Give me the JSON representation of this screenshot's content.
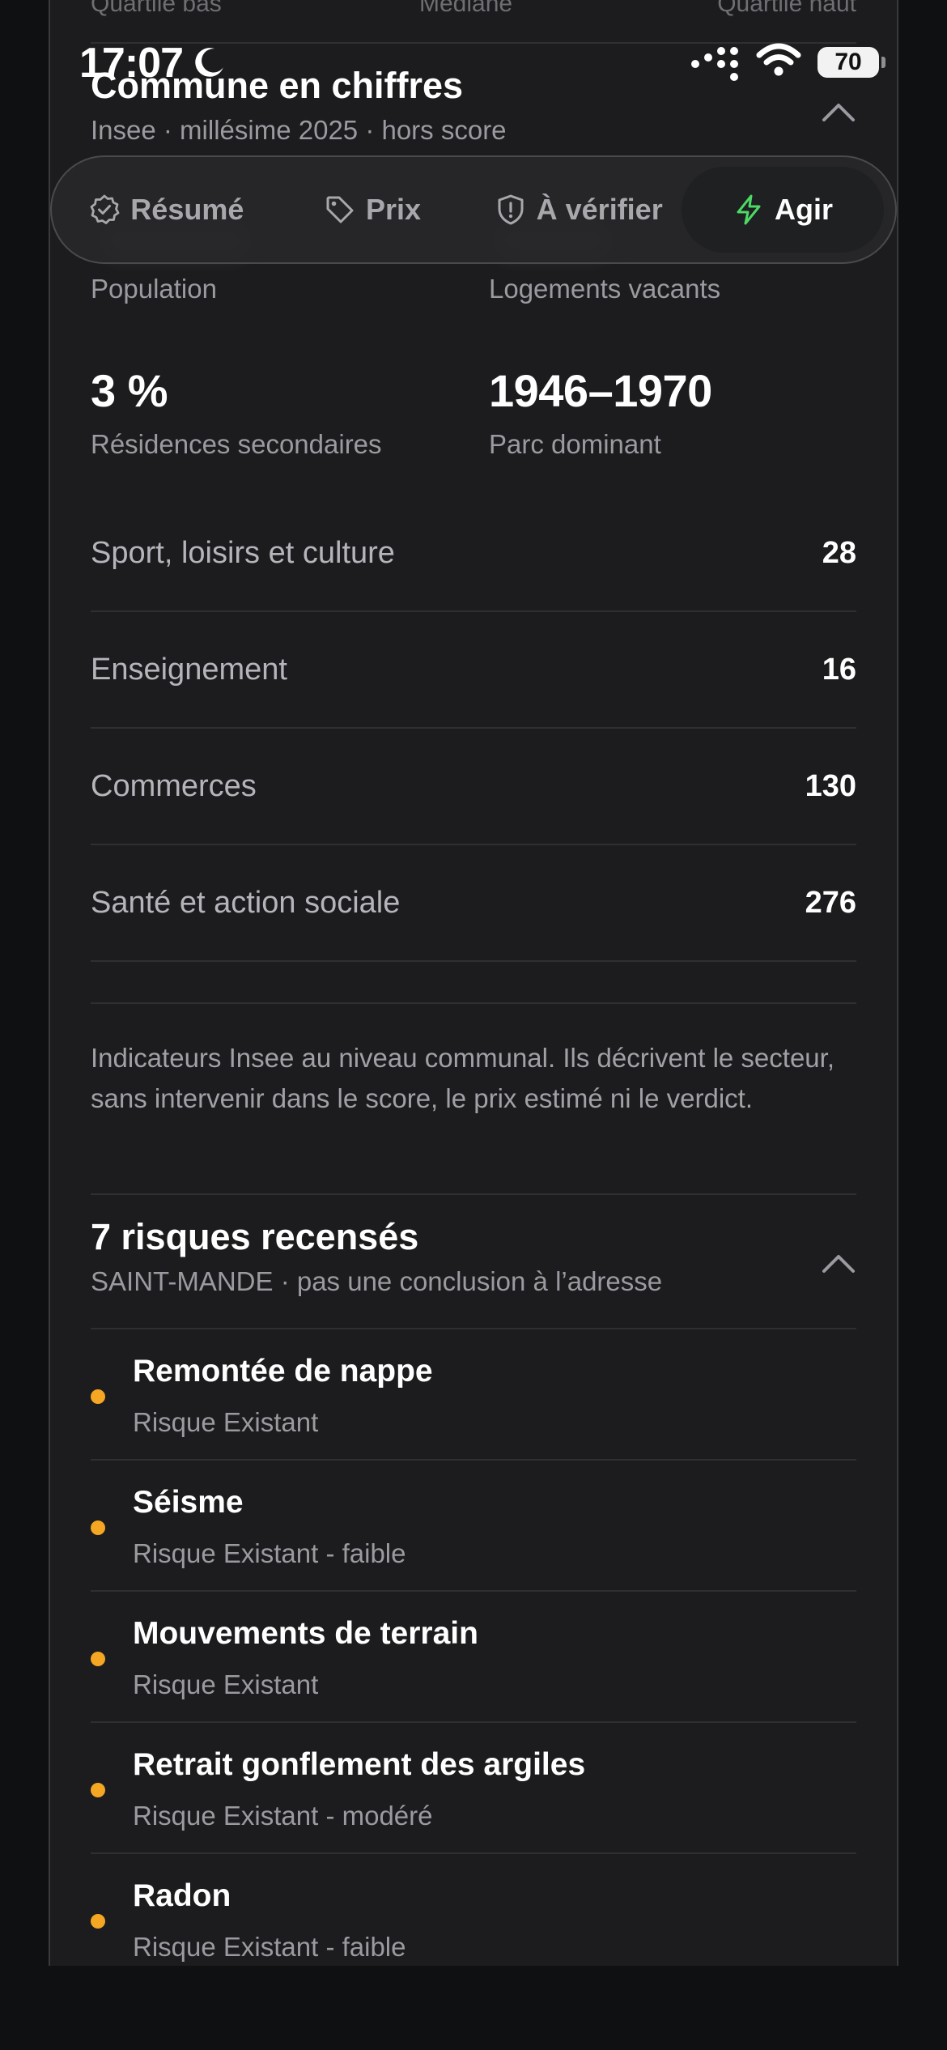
{
  "status_bar": {
    "time": "17:07",
    "battery": "70"
  },
  "faded_row": {
    "left": "Quartile bas",
    "center": "Médiane",
    "right": "Quartile haut"
  },
  "commune_section": {
    "title": "Commune en chiffres",
    "subtitle": "Insee · millésime 2025 · hors score",
    "stats": [
      {
        "value": "",
        "label": "Population"
      },
      {
        "value": "",
        "label": "Logements vacants"
      },
      {
        "value": "3 %",
        "label": "Résidences secondaires"
      },
      {
        "value": "1946–1970",
        "label": "Parc dominant"
      }
    ],
    "rows": [
      {
        "label": "Sport, loisirs et culture",
        "value": "28"
      },
      {
        "label": "Enseignement",
        "value": "16"
      },
      {
        "label": "Commerces",
        "value": "130"
      },
      {
        "label": "Santé et action sociale",
        "value": "276"
      }
    ],
    "note": "Indicateurs Insee au niveau communal. Ils décrivent le secteur, sans intervenir dans le score, le prix estimé ni le verdict."
  },
  "tabs": [
    {
      "label": "Résumé",
      "icon": "check-badge-icon",
      "active": false
    },
    {
      "label": "Prix",
      "icon": "tag-icon",
      "active": false
    },
    {
      "label": "À vérifier",
      "icon": "shield-alert-icon",
      "active": false
    },
    {
      "label": "Agir",
      "icon": "lightning-icon",
      "active": true
    }
  ],
  "risks_section": {
    "title": "7 risques recensés",
    "subtitle": "SAINT-MANDE · pas une conclusion à l’adresse",
    "items": [
      {
        "name": "Remontée de nappe",
        "detail": "Risque Existant"
      },
      {
        "name": "Séisme",
        "detail": "Risque Existant - faible"
      },
      {
        "name": "Mouvements de terrain",
        "detail": "Risque Existant"
      },
      {
        "name": "Retrait gonflement des argiles",
        "detail": "Risque Existant - modéré"
      },
      {
        "name": "Radon",
        "detail": "Risque Existant - faible"
      }
    ]
  },
  "colors": {
    "background": "#0f1012",
    "card": "#1c1c1e",
    "accent_green": "#4cd964",
    "risk_bullet": "#f5a623"
  }
}
